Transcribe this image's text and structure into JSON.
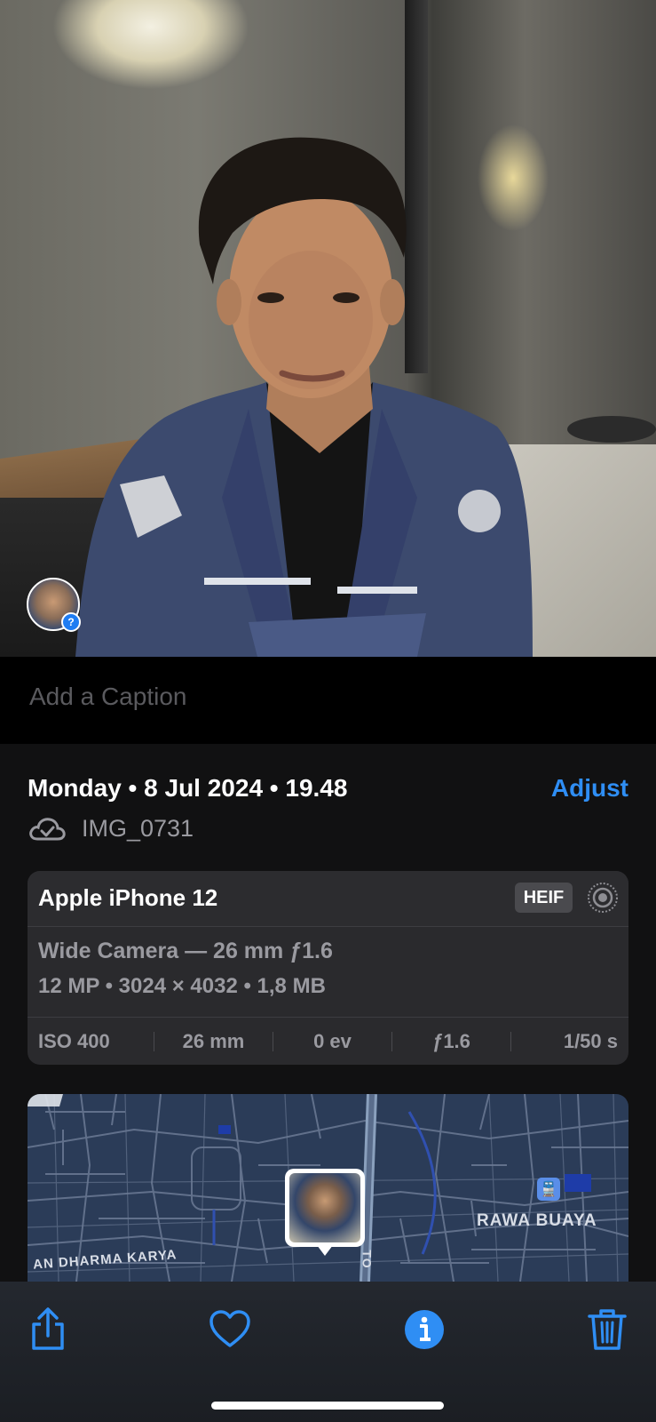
{
  "photo": {
    "face_badge": "?"
  },
  "caption": {
    "placeholder": "Add a Caption"
  },
  "info": {
    "date": "Monday • 8 Jul 2024 • 19.48",
    "adjust_label": "Adjust",
    "filename": "IMG_0731",
    "device": "Apple iPhone 12",
    "format_badge": "HEIF",
    "lens": "Wide Camera — 26 mm ƒ1.6",
    "specs": "12 MP  •  3024 × 4032  •  1,8 MB",
    "exif": {
      "iso": "ISO 400",
      "focal": "26 mm",
      "ev": "0 ev",
      "aperture": "ƒ1.6",
      "shutter": "1/50 s"
    }
  },
  "map": {
    "labels": {
      "district": "RAWA BUAYA",
      "street": "AN DHARMA KARYA",
      "road": "TO"
    },
    "train_glyph": "🚆"
  },
  "colors": {
    "accent": "#2f8ef4",
    "background": "#111112",
    "card": "#2a2a2d",
    "toolbar": "#1f2228"
  },
  "toolbar": {
    "icons": [
      "share-icon",
      "heart-icon",
      "info-icon",
      "trash-icon"
    ]
  }
}
